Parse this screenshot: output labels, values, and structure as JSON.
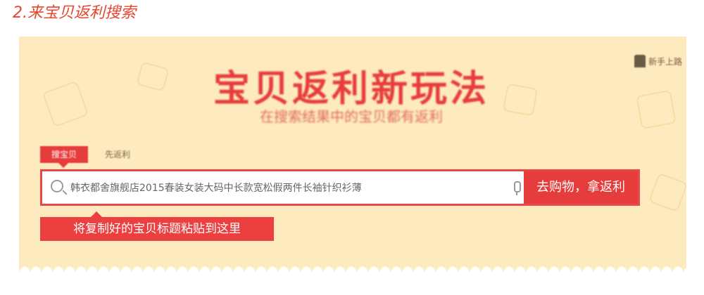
{
  "step_title": "2.来宝贝返利搜索",
  "banner": {
    "title": "宝贝返利新玩法",
    "subtitle": "在搜索结果中的宝贝都有返利",
    "corner_link": "新手上路"
  },
  "tabs": {
    "active": "搜宝贝",
    "other": "先返利"
  },
  "search": {
    "value": "韩衣都舍旗舰店2015春装女装大码中长款宽松假两件长袖针织衫薄",
    "button": "去购物，拿返利"
  },
  "hint": "将复制好的宝贝标题粘贴到这里",
  "colors": {
    "accent": "#e63c3c",
    "banner_bg": "#fdebbf"
  }
}
